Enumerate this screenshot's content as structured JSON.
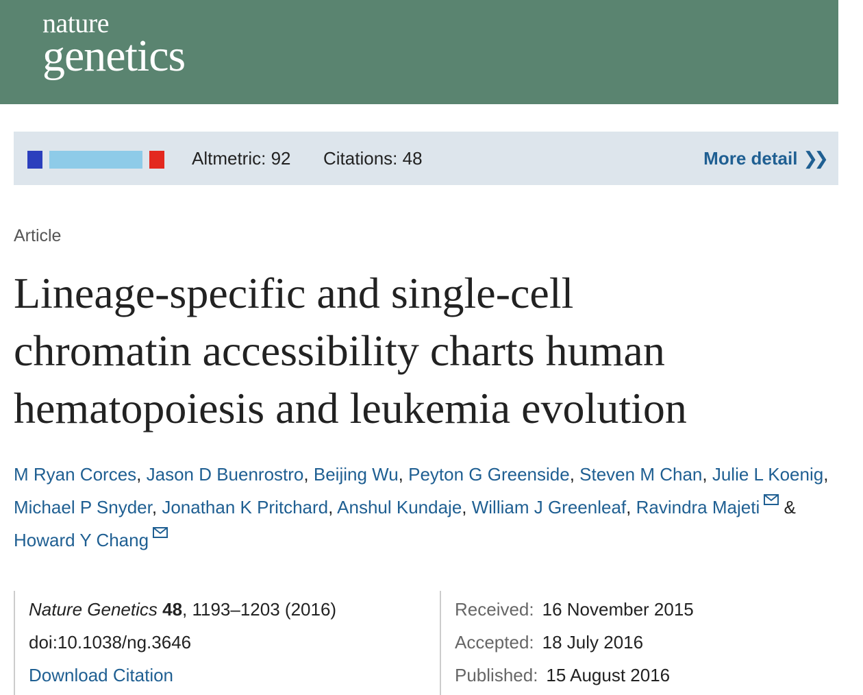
{
  "header": {
    "logo_line1": "nature",
    "logo_line2": "genetics",
    "brand_color": "#5a8470"
  },
  "metrics": {
    "altmetric_label": "Altmetric: 92",
    "citations_label": "Citations: 48",
    "more_detail_label": "More detail",
    "donut_colors": [
      "#2b3fbd",
      "#8ecbe8",
      "#e3281f"
    ]
  },
  "article": {
    "type": "Article",
    "title_lines": [
      "Lineage-specific and single-cell",
      "chromatin accessibility charts human",
      "hematopoiesis and leukemia evolution"
    ],
    "authors": [
      "M Ryan Corces",
      "Jason D Buenrostro",
      "Beijing Wu",
      "Peyton G Greenside",
      "Steven M Chan",
      "Julie L Koenig",
      "Michael P Snyder",
      "Jonathan K Pritchard",
      "Anshul Kundaje",
      "William J Greenleaf",
      "Ravindra Majeti",
      "Howard Y Chang"
    ],
    "ampersand": "&"
  },
  "citation": {
    "journal": "Nature Genetics",
    "volume": "48",
    "pages_year": ", 1193–1203 (2016)",
    "doi": "doi:10.1038/ng.3646",
    "download_label": "Download Citation"
  },
  "dates": {
    "received_label": "Received:",
    "received": "16 November 2015",
    "accepted_label": "Accepted:",
    "accepted": "18 July 2016",
    "published_label": "Published:",
    "published": "15 August 2016"
  },
  "icons": [
    "email-icon",
    "double-chevron-right-icon"
  ],
  "link_color": "#1f5f92"
}
